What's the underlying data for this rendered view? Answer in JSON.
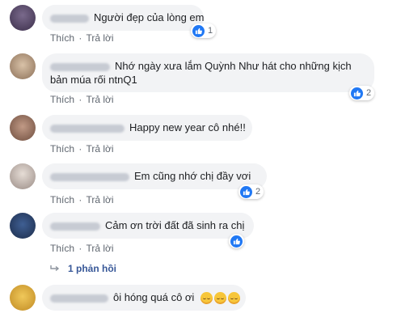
{
  "actions": {
    "like": "Thích",
    "reply": "Trả lời",
    "separator": "·"
  },
  "comments": [
    {
      "text": "Người đẹp của lòng em",
      "likes": "1"
    },
    {
      "text_line1": "Nhớ ngày xưa lắm Quỳnh Như hát cho những kịch",
      "text_line2": "bản múa rối ntnQ1",
      "likes": "2"
    },
    {
      "text": "Happy new year cô nhé!!"
    },
    {
      "text": "Em cũng nhớ chị đầy vơi",
      "likes": "2"
    },
    {
      "text": "Cảm ơn trời đất đã sinh ra chị",
      "likes": ""
    },
    {
      "text": "ôi hóng quá cô ơi"
    }
  ],
  "replies_link": "1 phản hồi",
  "icons": {
    "like": "thumbs-up-icon",
    "reply_arrow": "reply-arrow-icon",
    "emoji": "smiling-face-emoji"
  },
  "colors": {
    "like_blue": "#2078f4",
    "link": "#385898",
    "bubble": "#f2f3f5",
    "meta": "#606770"
  }
}
